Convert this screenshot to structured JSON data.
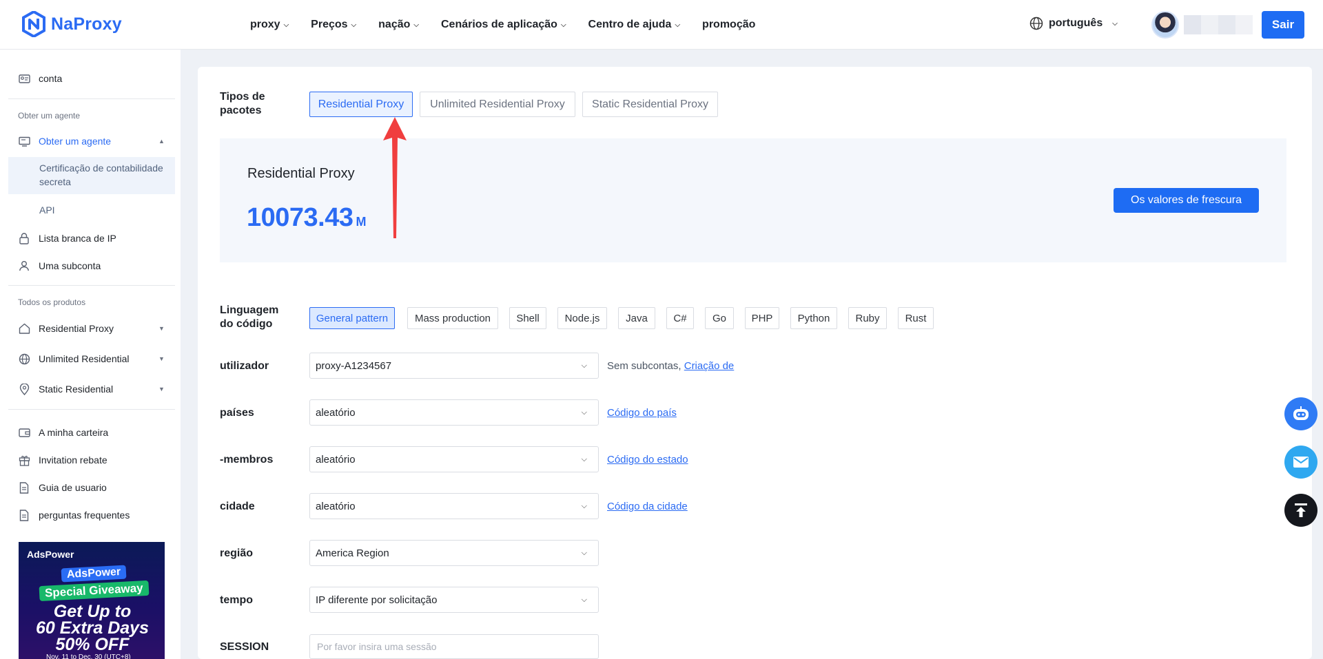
{
  "header": {
    "brand": "NaProxy",
    "nav": [
      {
        "label": "proxy"
      },
      {
        "label": "Preços"
      },
      {
        "label": "nação"
      },
      {
        "label": "Cenários de aplicação"
      },
      {
        "label": "Centro de ajuda"
      },
      {
        "label": "promoção"
      }
    ],
    "language": "português",
    "logout": "Sair"
  },
  "sidebar": {
    "account": "conta",
    "section_agent": "Obter um agente",
    "agent_menu": "Obter um agente",
    "sub_cert": "Certificação de contabilidade secreta",
    "sub_api": "API",
    "whitelist": "Lista branca de IP",
    "subaccount": "Uma subconta",
    "section_products": "Todos os produtos",
    "prod_residential": "Residential Proxy",
    "prod_unlimited": "Unlimited Residential",
    "prod_static": "Static Residential",
    "wallet": "A minha carteira",
    "invitation": "Invitation rebate",
    "guide": "Guia de usuario",
    "faq": "perguntas frequentes",
    "ad": {
      "brand": "AdsPower",
      "line1": "AdsPower",
      "line2": "Special Giveaway",
      "line3": "Get Up to",
      "line4": "60 Extra Days",
      "line5": "50% OFF",
      "line6": "Nov. 11 to Dec. 30 (UTC+8)"
    }
  },
  "main": {
    "package_label": "Tipos de pacotes",
    "packages": [
      {
        "label": "Residential Proxy",
        "active": true
      },
      {
        "label": "Unlimited Residential Proxy",
        "active": false
      },
      {
        "label": "Static Residential Proxy",
        "active": false
      }
    ],
    "balance": {
      "title": "Residential Proxy",
      "value": "10073.43",
      "unit": "M",
      "button": "Os valores de frescura"
    },
    "code_label": "Linguagem do código",
    "code_languages": [
      {
        "label": "General pattern",
        "active": true
      },
      {
        "label": "Mass production"
      },
      {
        "label": "Shell"
      },
      {
        "label": "Node.js"
      },
      {
        "label": "Java"
      },
      {
        "label": "C#"
      },
      {
        "label": "Go"
      },
      {
        "label": "PHP"
      },
      {
        "label": "Python"
      },
      {
        "label": "Ruby"
      },
      {
        "label": "Rust"
      }
    ],
    "fields": {
      "user": {
        "label": "utilizador",
        "value": "proxy-A1234567",
        "hint": "Sem subcontas,",
        "link": "Criação de"
      },
      "country": {
        "label": "países",
        "value": "aleatório",
        "link": "Código do país"
      },
      "state": {
        "label": "-membros",
        "value": "aleatório",
        "link": "Código do estado"
      },
      "city": {
        "label": "cidade",
        "value": "aleatório",
        "link": "Código da cidade"
      },
      "region": {
        "label": "região",
        "value": "America Region"
      },
      "time": {
        "label": "tempo",
        "value": "IP diferente por solicitação"
      },
      "session": {
        "label": "SESSION",
        "placeholder": "Por favor insira uma sessão"
      }
    }
  },
  "colors": {
    "primary": "#1e6cf3",
    "accent_blue": "#2b6bf3",
    "annotation_arrow": "#f03e3e"
  }
}
